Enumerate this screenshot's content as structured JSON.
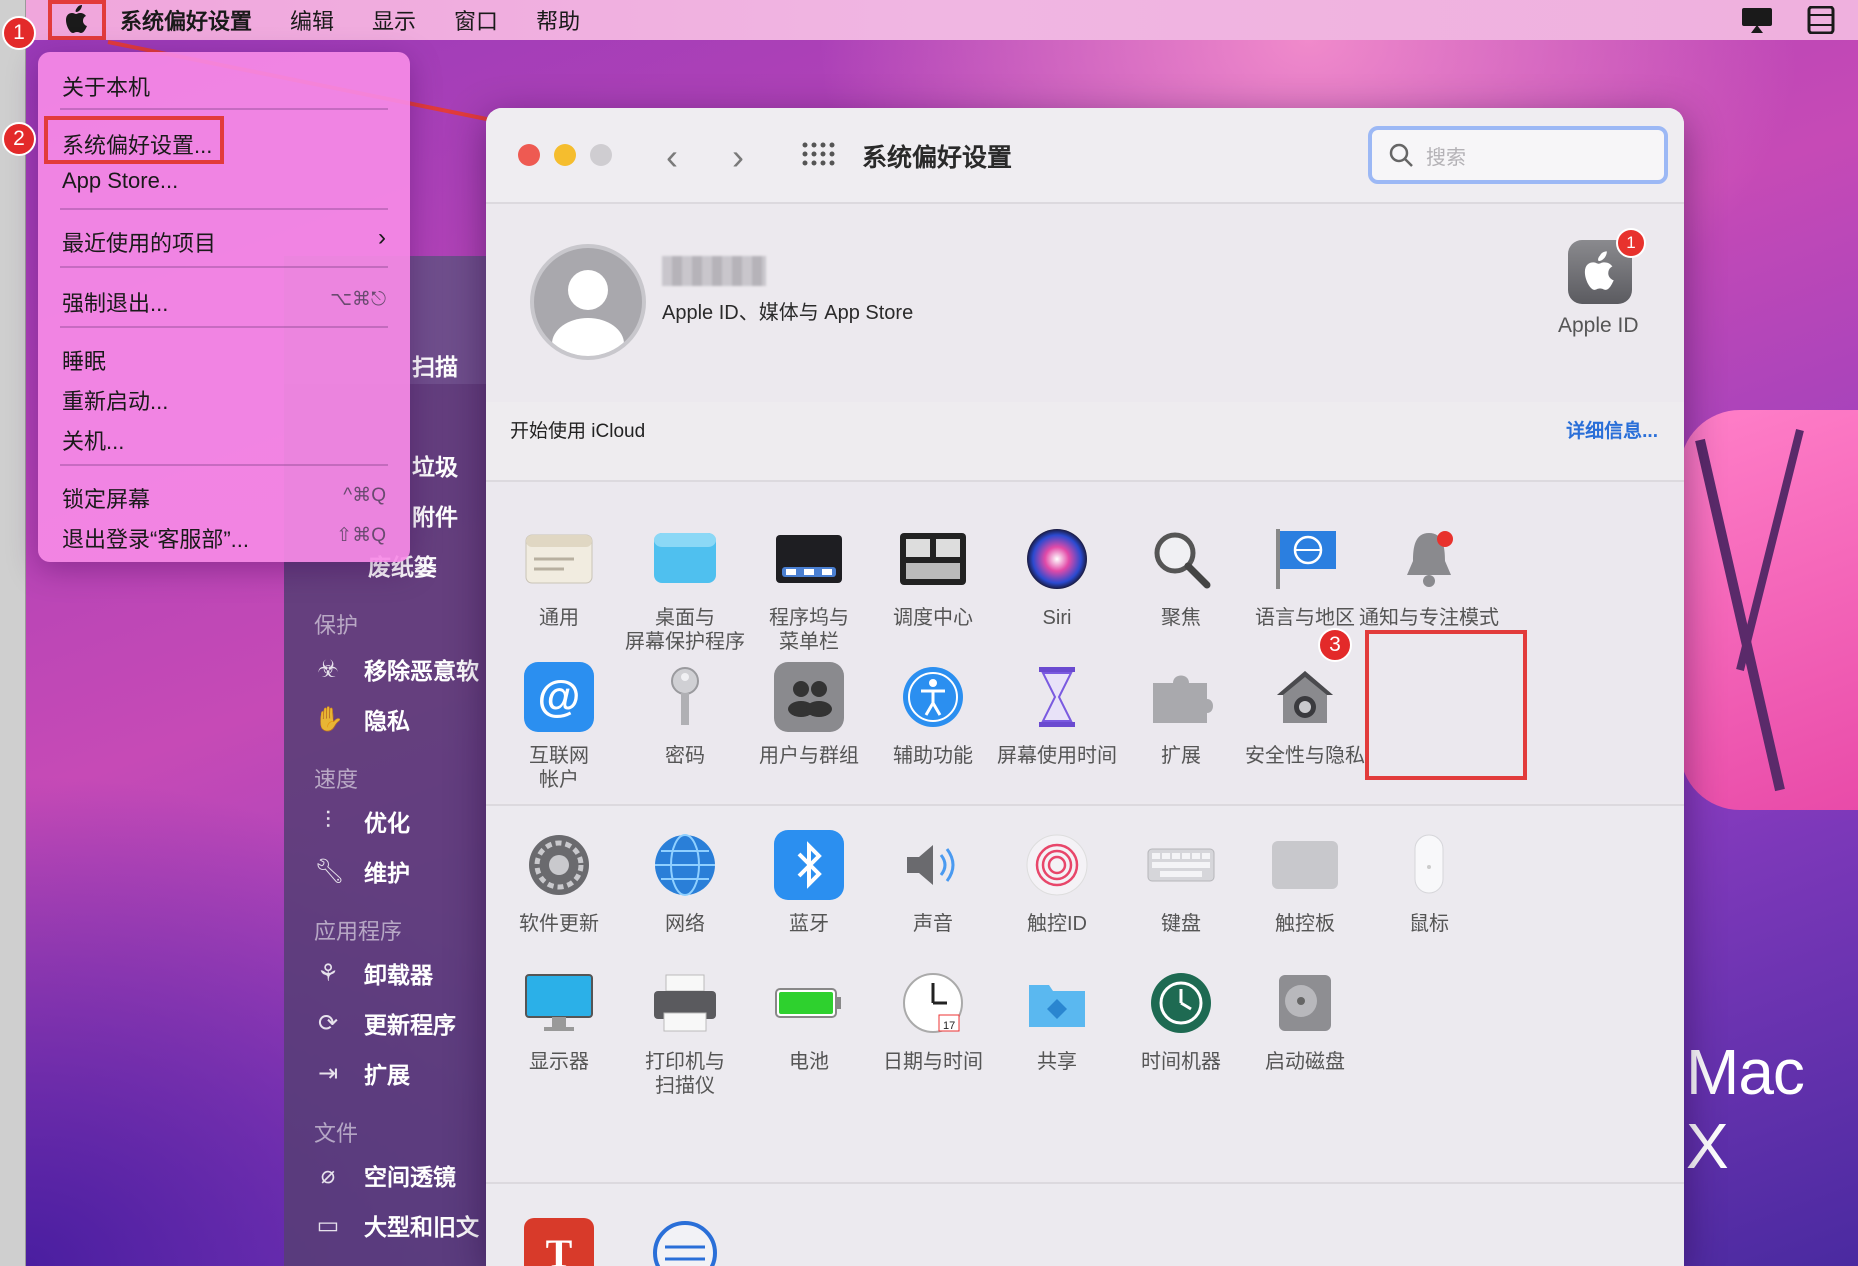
{
  "menubar": {
    "apple_label": "",
    "items": [
      "系统偏好设置",
      "编辑",
      "显示",
      "窗口",
      "帮助"
    ]
  },
  "apple_menu": {
    "about": "关于本机",
    "sysprefs": "系统偏好设置...",
    "appstore": "App Store...",
    "recent": "最近使用的项目",
    "force_quit": "强制退出...",
    "force_quit_shortcut": "⌥⌘⎋",
    "sleep": "睡眠",
    "restart": "重新启动...",
    "shutdown": "关机...",
    "lock": "锁定屏幕",
    "lock_shortcut": "^⌘Q",
    "logout": "退出登录“客服部”...",
    "logout_shortcut": "⇧⌘Q"
  },
  "badges": {
    "one": "1",
    "two": "2",
    "three": "3"
  },
  "bg_app": {
    "top_item": "扫描",
    "items_partial": [
      "垃圾",
      "附件",
      "废纸篓"
    ],
    "sec_protect": "保护",
    "malware": "移除恶意软",
    "privacy": "隐私",
    "sec_speed": "速度",
    "optimize": "优化",
    "maintain": "维护",
    "sec_apps": "应用程序",
    "uninstaller": "卸载器",
    "updater": "更新程序",
    "extensions": "扩展",
    "sec_files": "文件",
    "space_lens": "空间透镜",
    "large_old": "大型和旧文"
  },
  "desktop": {
    "mac_text": "Mac X"
  },
  "window": {
    "title": "系统偏好设置",
    "search_placeholder": "搜索",
    "account_sub": "Apple ID、媒体与 App Store",
    "appleid_label": "Apple ID",
    "appleid_badge": "1",
    "icloud_text": "开始使用 iCloud",
    "more_link": "详细信息..."
  },
  "panes_row1": [
    "通用",
    "桌面与\n屏幕保护程序",
    "程序坞与\n菜单栏",
    "调度中心",
    "Siri",
    "聚焦",
    "语言与地区",
    "通知与专注模式"
  ],
  "panes_row2": [
    "互联网\n帐户",
    "密码",
    "用户与群组",
    "辅助功能",
    "屏幕使用时间",
    "扩展",
    "安全性与隐私"
  ],
  "panes_row3": [
    "软件更新",
    "网络",
    "蓝牙",
    "声音",
    "触控ID",
    "键盘",
    "触控板",
    "鼠标"
  ],
  "panes_row4": [
    "显示器",
    "打印机与\n扫描仪",
    "电池",
    "日期与时间",
    "共享",
    "时间机器",
    "启动磁盘"
  ],
  "colors": {
    "highlight": "#e23b3b",
    "link": "#2a6fd8"
  }
}
